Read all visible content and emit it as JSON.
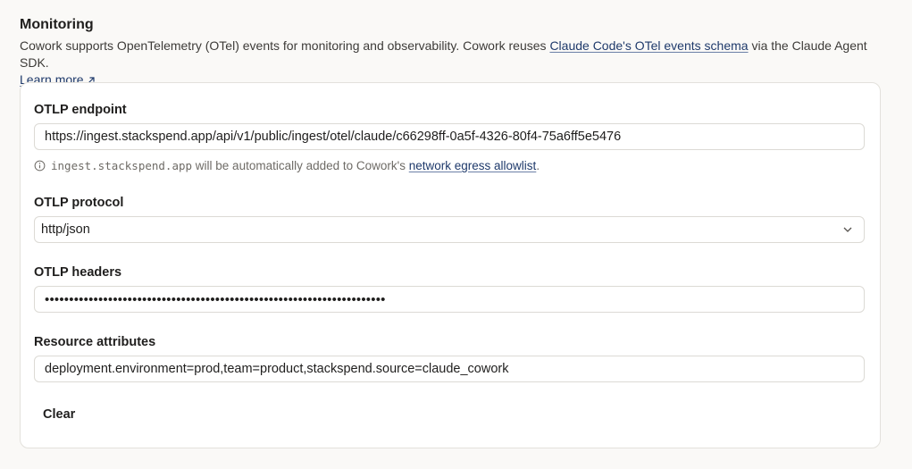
{
  "section": {
    "title": "Monitoring",
    "description_prefix": "Cowork supports OpenTelemetry (OTel) events for monitoring and observability. Cowork reuses ",
    "schema_link": "Claude Code's OTel events schema",
    "description_suffix": " via the Claude Agent SDK.",
    "learn_more": "Learn more"
  },
  "form": {
    "endpoint": {
      "label": "OTLP endpoint",
      "value": "https://ingest.stackspend.app/api/v1/public/ingest/otel/claude/c66298ff-0a5f-4326-80f4-75a6ff5e5476",
      "hint_host": "ingest.stackspend.app",
      "hint_text": " will be automatically added to Cowork's ",
      "hint_link": "network egress allowlist",
      "hint_end": "."
    },
    "protocol": {
      "label": "OTLP protocol",
      "value": "http/json"
    },
    "headers": {
      "label": "OTLP headers",
      "value": "••••••••••••••••••••••••••••••••••••••••••••••••••••••••••••••••••••••"
    },
    "resource": {
      "label": "Resource attributes",
      "value": "deployment.environment=prod,team=product,stackspend.source=claude_cowork"
    },
    "clear_label": "Clear"
  },
  "icons": {
    "external": "external-link-icon",
    "info": "info-icon",
    "chevron": "chevron-down-icon"
  }
}
